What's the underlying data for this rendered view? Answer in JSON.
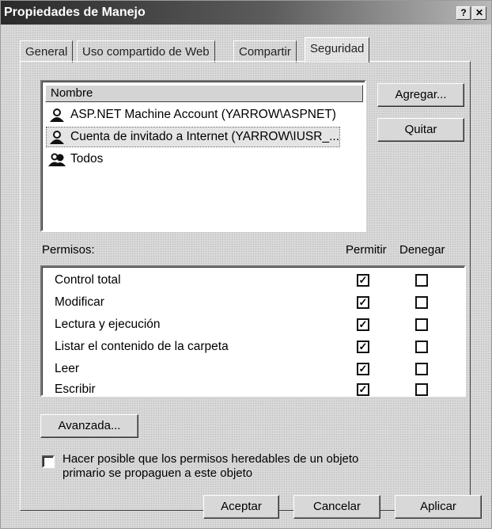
{
  "window": {
    "title": "Propiedades de Manejo",
    "help_label": "?",
    "close_label": "✕"
  },
  "tabs": [
    {
      "label": "General"
    },
    {
      "label": "Uso compartido de Web"
    },
    {
      "label": "Compartir"
    },
    {
      "label": "Seguridad",
      "active": true
    }
  ],
  "users": {
    "column_header": "Nombre",
    "items": [
      {
        "name": "ASP.NET Machine Account (YARROW\\ASPNET)",
        "icon": "user-icon",
        "selected": false
      },
      {
        "name": "Cuenta de invitado a Internet (YARROW\\IUSR_...",
        "icon": "user-icon",
        "selected": true
      },
      {
        "name": "Todos",
        "icon": "group-icon",
        "selected": false
      }
    ],
    "add_label": "Agregar...",
    "remove_label": "Quitar"
  },
  "permissions": {
    "label": "Permisos:",
    "allow_header": "Permitir",
    "deny_header": "Denegar",
    "rows": [
      {
        "name": "Control total",
        "allow": true,
        "deny": false
      },
      {
        "name": "Modificar",
        "allow": true,
        "deny": false
      },
      {
        "name": "Lectura y ejecución",
        "allow": true,
        "deny": false
      },
      {
        "name": "Listar el contenido de la carpeta",
        "allow": true,
        "deny": false
      },
      {
        "name": "Leer",
        "allow": true,
        "deny": false
      },
      {
        "name": "Escribir",
        "allow": true,
        "deny": false
      }
    ]
  },
  "advanced_label": "Avanzada...",
  "inherit": {
    "line1": "Hacer posible que los permisos heredables de un objeto",
    "line2": "primario se propaguen a este objeto",
    "checked": false
  },
  "footer": {
    "ok_label": "Aceptar",
    "cancel_label": "Cancelar",
    "apply_label": "Aplicar"
  }
}
